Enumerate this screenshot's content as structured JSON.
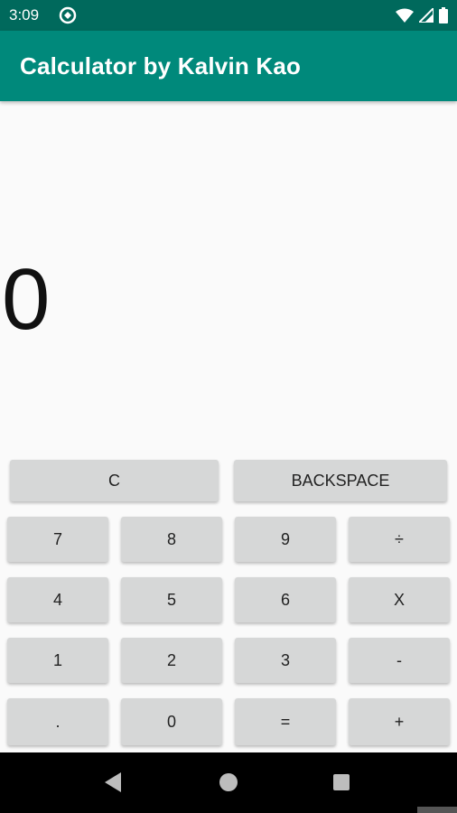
{
  "status_bar": {
    "time": "3:09"
  },
  "app_bar": {
    "title": "Calculator by Kalvin Kao"
  },
  "display": {
    "value": "0"
  },
  "keypad": {
    "top_row": [
      {
        "id": "clear",
        "label": "C"
      },
      {
        "id": "backspace",
        "label": "BACKSPACE"
      }
    ],
    "rows": [
      [
        {
          "label": "7"
        },
        {
          "label": "8"
        },
        {
          "label": "9"
        },
        {
          "label": "÷"
        }
      ],
      [
        {
          "label": "4"
        },
        {
          "label": "5"
        },
        {
          "label": "6"
        },
        {
          "label": "X"
        }
      ],
      [
        {
          "label": "1"
        },
        {
          "label": "2"
        },
        {
          "label": "3"
        },
        {
          "label": "-"
        }
      ],
      [
        {
          "label": "."
        },
        {
          "label": "0"
        },
        {
          "label": "="
        },
        {
          "label": "+"
        }
      ]
    ]
  },
  "colors": {
    "status_bar": "#00695c",
    "app_bar": "#00897b",
    "key_background": "#d6d7d7",
    "background": "#fafafa"
  },
  "icons": {
    "status": [
      "sync-icon",
      "wifi-icon",
      "signal-icon",
      "battery-icon"
    ],
    "navigation": [
      "back-icon",
      "home-icon",
      "recents-icon"
    ]
  }
}
